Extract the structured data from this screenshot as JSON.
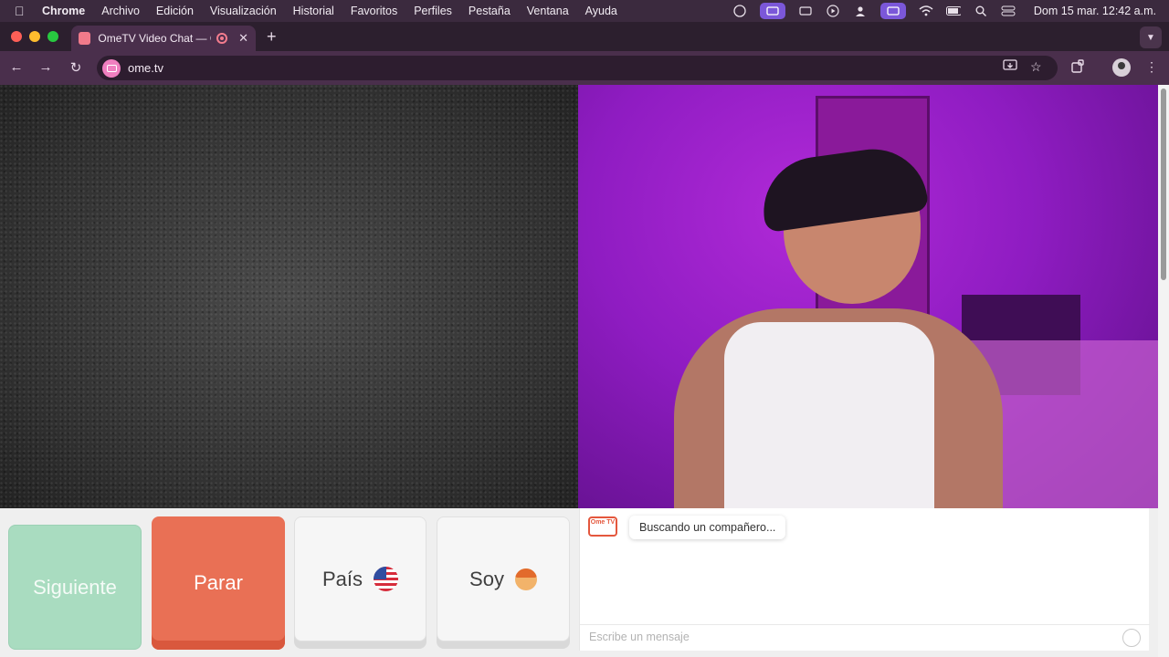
{
  "menubar": {
    "app": "Chrome",
    "items": [
      "Archivo",
      "Edición",
      "Visualización",
      "Historial",
      "Favoritos",
      "Perfiles",
      "Pestaña",
      "Ventana",
      "Ayuda"
    ],
    "datetime": "Dom 15 mar.  12:42 a.m."
  },
  "tab": {
    "title": "OmeTV Video Chat — Om"
  },
  "toolbar": {
    "url": "ome.tv"
  },
  "controls": {
    "next": "Siguiente",
    "stop": "Parar",
    "country": "País",
    "iam": "Soy"
  },
  "chat": {
    "logo": "Ome TV",
    "status": "Buscando un compañero...",
    "placeholder": "Escribe un mensaje"
  },
  "colors": {
    "next": "#a9dcc0",
    "stop": "#e97055",
    "accent": "#e4573d"
  }
}
